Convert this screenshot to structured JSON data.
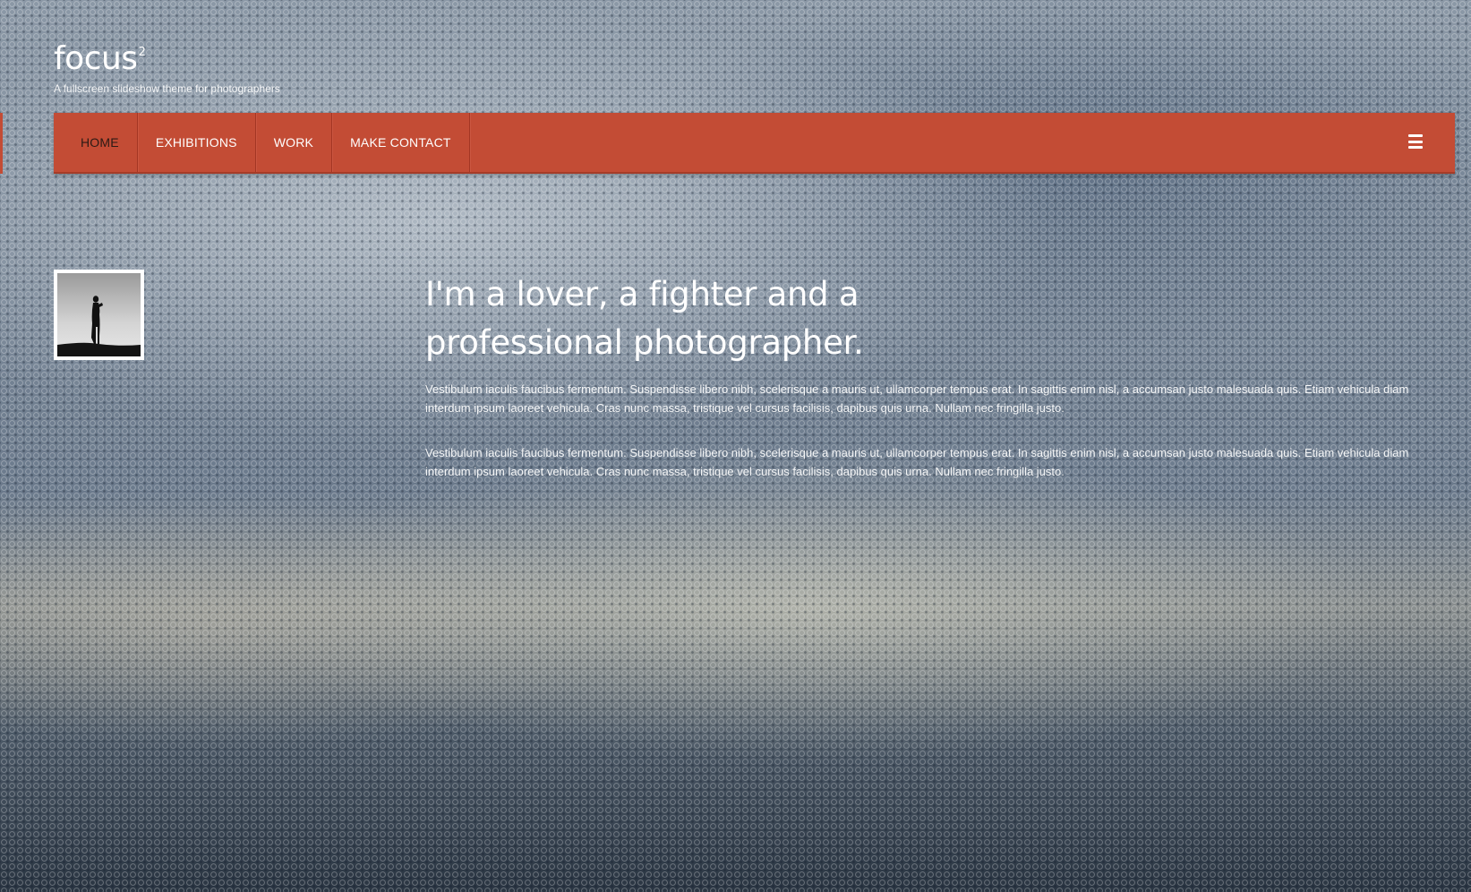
{
  "site": {
    "logo_text": "focus",
    "logo_superscript": "2",
    "tagline": "A fullscreen slideshow theme for photographers"
  },
  "nav": {
    "items": [
      {
        "label": "HOME",
        "active": true
      },
      {
        "label": "EXHIBITIONS",
        "active": false
      },
      {
        "label": "WORK",
        "active": false
      },
      {
        "label": "MAKE CONTACT",
        "active": false
      }
    ],
    "menu_icon": "hamburger-menu-icon",
    "bar_color": "#c34c35"
  },
  "profile": {
    "avatar_icon": "photographer-silhouette-image"
  },
  "intro": {
    "headline_line1": "I'm a lover, a fighter and a",
    "headline_line2": "professional photographer.",
    "paragraph_1": "Vestibulum iaculis faucibus fermentum. Suspendisse libero nibh, scelerisque a mauris ut, ullamcorper tempus erat. In sagittis enim nisl, a accumsan justo malesuada quis. Etiam vehicula diam interdum ipsum laoreet vehicula. Cras nunc massa, tristique vel cursus facilisis, dapibus quis urna. Nullam nec fringilla justo.",
    "paragraph_2": "Vestibulum iaculis faucibus fermentum. Suspendisse libero nibh, scelerisque a mauris ut, ullamcorper tempus erat. In sagittis enim nisl, a accumsan justo malesuada quis. Etiam vehicula diam interdum ipsum laoreet vehicula. Cras nunc massa, tristique vel cursus facilisis, dapibus quis urna. Nullam nec fringilla justo."
  }
}
